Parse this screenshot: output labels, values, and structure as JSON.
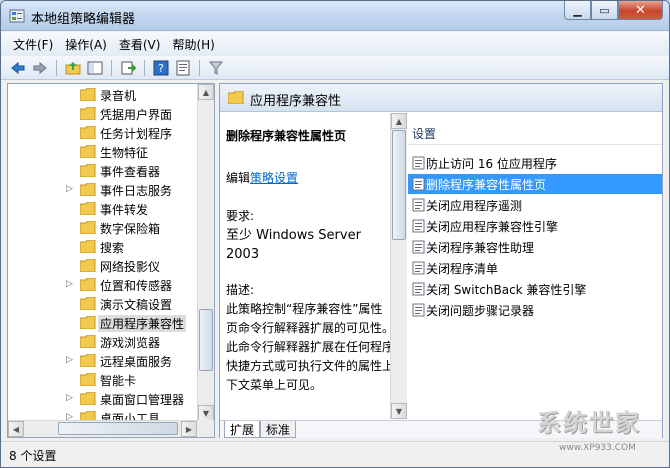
{
  "window": {
    "title": "本地组策略编辑器"
  },
  "menu": [
    {
      "label": "文件(F)"
    },
    {
      "label": "操作(A)"
    },
    {
      "label": "查看(V)"
    },
    {
      "label": "帮助(H)"
    }
  ],
  "toolbar": {
    "icons": [
      "back-arrow-icon",
      "forward-arrow-icon",
      "up-folder-icon",
      "show-tree-icon",
      "export-list-icon",
      "help-icon",
      "properties-icon",
      "filter-icon"
    ]
  },
  "tree": {
    "items": [
      {
        "label": "录音机",
        "expandable": false,
        "selected": false
      },
      {
        "label": "凭据用户界面",
        "expandable": false,
        "selected": false
      },
      {
        "label": "任务计划程序",
        "expandable": false,
        "selected": false
      },
      {
        "label": "生物特征",
        "expandable": false,
        "selected": false
      },
      {
        "label": "事件查看器",
        "expandable": false,
        "selected": false
      },
      {
        "label": "事件日志服务",
        "expandable": true,
        "selected": false
      },
      {
        "label": "事件转发",
        "expandable": false,
        "selected": false
      },
      {
        "label": "数字保险箱",
        "expandable": false,
        "selected": false
      },
      {
        "label": "搜索",
        "expandable": false,
        "selected": false
      },
      {
        "label": "网络投影仪",
        "expandable": false,
        "selected": false
      },
      {
        "label": "位置和传感器",
        "expandable": true,
        "selected": false
      },
      {
        "label": "演示文稿设置",
        "expandable": false,
        "selected": false
      },
      {
        "label": "应用程序兼容性",
        "expandable": false,
        "selected": true
      },
      {
        "label": "游戏浏览器",
        "expandable": false,
        "selected": false
      },
      {
        "label": "远程桌面服务",
        "expandable": true,
        "selected": false
      },
      {
        "label": "智能卡",
        "expandable": false,
        "selected": false
      },
      {
        "label": "桌面窗口管理器",
        "expandable": true,
        "selected": false
      },
      {
        "label": "桌面小工具",
        "expandable": true,
        "selected": false
      }
    ]
  },
  "right": {
    "header": "应用程序兼容性",
    "description": {
      "title": "删除程序兼容性属性页",
      "edit_prefix": "编辑",
      "edit_link": "策略设置",
      "requirements_label": "要求:",
      "requirements": "至少 Windows Server 2003",
      "description_label": "描述:",
      "description": "此策略控制“程序兼容性”属性页命令行解释器扩展的可见性。此命令行解释器扩展在任何程序快捷方式或可执行文件的属性上下文菜单上可见。"
    },
    "settings_header": "设置",
    "settings": [
      {
        "label": "防止访问 16 位应用程序",
        "selected": false
      },
      {
        "label": "删除程序兼容性属性页",
        "selected": true
      },
      {
        "label": "关闭应用程序遥测",
        "selected": false
      },
      {
        "label": "关闭应用程序兼容性引擎",
        "selected": false
      },
      {
        "label": "关闭程序兼容性助理",
        "selected": false
      },
      {
        "label": "关闭程序清单",
        "selected": false
      },
      {
        "label": "关闭 SwitchBack 兼容性引擎",
        "selected": false
      },
      {
        "label": "关闭问题步骤记录器",
        "selected": false
      }
    ],
    "tabs": [
      {
        "label": "扩展",
        "active": true
      },
      {
        "label": "标准",
        "active": false
      }
    ]
  },
  "status": {
    "text": "8 个设置"
  },
  "colors": {
    "selection": "#3399ff",
    "link": "#0066cc",
    "folder": "#f2c94c"
  }
}
